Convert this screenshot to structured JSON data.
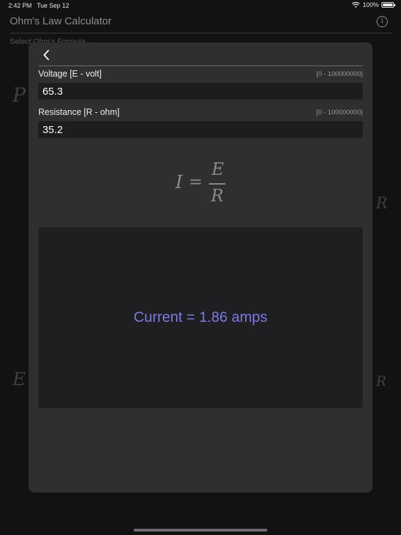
{
  "status_bar": {
    "time": "2:42 PM",
    "date": "Tue Sep 12",
    "battery": "100%"
  },
  "background": {
    "title": "Ohm's Law Calculator",
    "subtitle": "Select Ohm's Formula",
    "info_icon": "i"
  },
  "sheet": {
    "voltage": {
      "label": "Voltage [E - volt]",
      "range": "[0 - 100000000]",
      "value": "65.3"
    },
    "resistance": {
      "label": "Resistance [R - ohm]",
      "range": "[0 - 100000000]",
      "value": "35.2"
    },
    "formula": {
      "lhs": "I",
      "eq": "=",
      "numerator": "E",
      "denominator": "R"
    },
    "result": "Current = 1.86 amps"
  },
  "colors": {
    "result_text": "#7b7be8",
    "sheet_bg": "#2f2f31",
    "input_bg": "#1d1d1f"
  }
}
